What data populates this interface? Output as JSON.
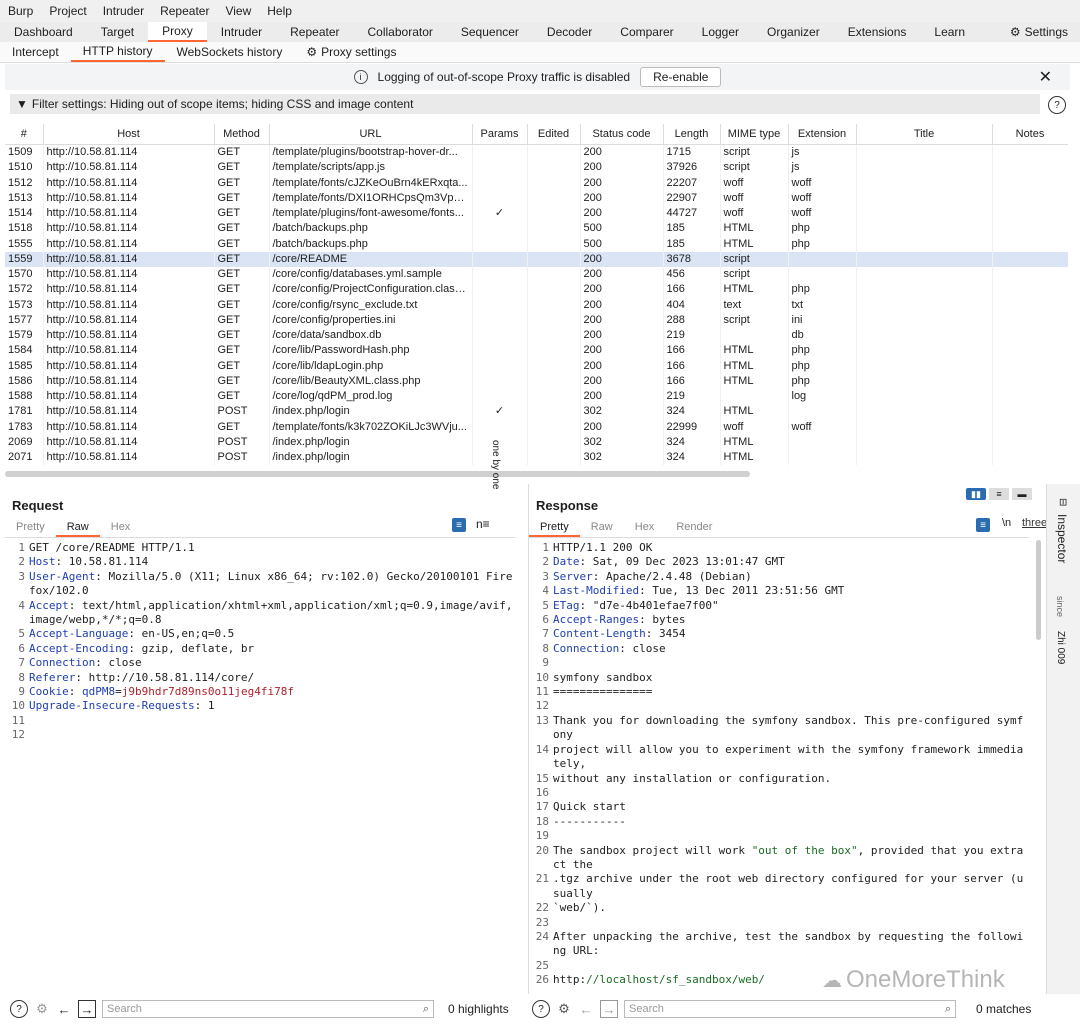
{
  "menu": [
    "Burp",
    "Project",
    "Intruder",
    "Repeater",
    "View",
    "Help"
  ],
  "main_tabs": [
    "Dashboard",
    "Target",
    "Proxy",
    "Intruder",
    "Repeater",
    "Collaborator",
    "Sequencer",
    "Decoder",
    "Comparer",
    "Logger",
    "Organizer",
    "Extensions",
    "Learn"
  ],
  "active_main_tab": "Proxy",
  "settings_label": "Settings",
  "proxy_tabs": [
    "Intercept",
    "HTTP history",
    "WebSockets history",
    "Proxy settings"
  ],
  "active_proxy_tab": "HTTP history",
  "info": {
    "message": "Logging of out-of-scope Proxy traffic is disabled",
    "button": "Re-enable"
  },
  "filter": {
    "text": "Filter settings: Hiding out of scope items;  hiding CSS and image content"
  },
  "table": {
    "columns": [
      "#",
      "Host",
      "Method",
      "URL",
      "Params",
      "Edited",
      "Status code",
      "Length",
      "MIME type",
      "Extension",
      "Title",
      "Notes"
    ],
    "rows": [
      [
        "1509",
        "http://10.58.81.114",
        "GET",
        "/template/plugins/bootstrap-hover-dr...",
        "",
        "",
        "200",
        "1715",
        "script",
        "js",
        "",
        ""
      ],
      [
        "1510",
        "http://10.58.81.114",
        "GET",
        "/template/scripts/app.js",
        "",
        "",
        "200",
        "37926",
        "script",
        "js",
        "",
        ""
      ],
      [
        "1512",
        "http://10.58.81.114",
        "GET",
        "/template/fonts/cJZKeOuBrn4kERxqta...",
        "",
        "",
        "200",
        "22207",
        "woff",
        "woff",
        "",
        ""
      ],
      [
        "1513",
        "http://10.58.81.114",
        "GET",
        "/template/fonts/DXI1ORHCpsQm3Vp6...",
        "",
        "",
        "200",
        "22907",
        "woff",
        "woff",
        "",
        ""
      ],
      [
        "1514",
        "http://10.58.81.114",
        "GET",
        "/template/plugins/font-awesome/fonts...",
        "✓",
        "",
        "200",
        "44727",
        "woff",
        "woff",
        "",
        ""
      ],
      [
        "1518",
        "http://10.58.81.114",
        "GET",
        "/batch/backups.php",
        "",
        "",
        "500",
        "185",
        "HTML",
        "php",
        "",
        ""
      ],
      [
        "1555",
        "http://10.58.81.114",
        "GET",
        "/batch/backups.php",
        "",
        "",
        "500",
        "185",
        "HTML",
        "php",
        "",
        ""
      ],
      [
        "1559",
        "http://10.58.81.114",
        "GET",
        "/core/README",
        "",
        "",
        "200",
        "3678",
        "script",
        "",
        "",
        ""
      ],
      [
        "1570",
        "http://10.58.81.114",
        "GET",
        "/core/config/databases.yml.sample",
        "",
        "",
        "200",
        "456",
        "script",
        "",
        "",
        ""
      ],
      [
        "1572",
        "http://10.58.81.114",
        "GET",
        "/core/config/ProjectConfiguration.class....",
        "",
        "",
        "200",
        "166",
        "HTML",
        "php",
        "",
        ""
      ],
      [
        "1573",
        "http://10.58.81.114",
        "GET",
        "/core/config/rsync_exclude.txt",
        "",
        "",
        "200",
        "404",
        "text",
        "txt",
        "",
        ""
      ],
      [
        "1577",
        "http://10.58.81.114",
        "GET",
        "/core/config/properties.ini",
        "",
        "",
        "200",
        "288",
        "script",
        "ini",
        "",
        ""
      ],
      [
        "1579",
        "http://10.58.81.114",
        "GET",
        "/core/data/sandbox.db",
        "",
        "",
        "200",
        "219",
        "",
        "db",
        "",
        ""
      ],
      [
        "1584",
        "http://10.58.81.114",
        "GET",
        "/core/lib/PasswordHash.php",
        "",
        "",
        "200",
        "166",
        "HTML",
        "php",
        "",
        ""
      ],
      [
        "1585",
        "http://10.58.81.114",
        "GET",
        "/core/lib/ldapLogin.php",
        "",
        "",
        "200",
        "166",
        "HTML",
        "php",
        "",
        ""
      ],
      [
        "1586",
        "http://10.58.81.114",
        "GET",
        "/core/lib/BeautyXML.class.php",
        "",
        "",
        "200",
        "166",
        "HTML",
        "php",
        "",
        ""
      ],
      [
        "1588",
        "http://10.58.81.114",
        "GET",
        "/core/log/qdPM_prod.log",
        "",
        "",
        "200",
        "219",
        "",
        "log",
        "",
        ""
      ],
      [
        "1781",
        "http://10.58.81.114",
        "POST",
        "/index.php/login",
        "✓",
        "",
        "302",
        "324",
        "HTML",
        "",
        "",
        ""
      ],
      [
        "1783",
        "http://10.58.81.114",
        "GET",
        "/template/fonts/k3k702ZOKiLJc3WVju...",
        "",
        "",
        "200",
        "22999",
        "woff",
        "woff",
        "",
        ""
      ],
      [
        "2069",
        "http://10.58.81.114",
        "POST",
        "/index.php/login",
        "",
        "",
        "302",
        "324",
        "HTML",
        "",
        "",
        ""
      ],
      [
        "2071",
        "http://10.58.81.114",
        "POST",
        "/index.php/login",
        "",
        "",
        "302",
        "324",
        "HTML",
        "",
        "",
        ""
      ]
    ],
    "selected_row": "1559"
  },
  "divider_label": "one by one",
  "request": {
    "title": "Request",
    "tabs": [
      "Pretty",
      "Raw",
      "Hex"
    ],
    "active_tab": "Raw",
    "lines": [
      {
        "n": "1",
        "t": "GET /core/README HTTP/1.1"
      },
      {
        "n": "2",
        "k": "Host",
        "v": "10.58.81.114"
      },
      {
        "n": "3",
        "k": "User-Agent",
        "v": "Mozilla/5.0 (X11; Linux x86_64; rv:102.0) Gecko/20100101 Firefox/102.0"
      },
      {
        "n": "4",
        "k": "Accept",
        "v": "text/html,application/xhtml+xml,application/xml;q=0.9,image/avif,image/webp,*/*;q=0.8"
      },
      {
        "n": "5",
        "k": "Accept-Language",
        "v": "en-US,en;q=0.5"
      },
      {
        "n": "6",
        "k": "Accept-Encoding",
        "v": "gzip, deflate, br"
      },
      {
        "n": "7",
        "k": "Connection",
        "v": "close"
      },
      {
        "n": "8",
        "k": "Referer",
        "v": "http://10.58.81.114/core/"
      },
      {
        "n": "9",
        "k": "Cookie",
        "ck": "qdPM8",
        "cv": "j9b9hdr7d89ns0o11jeg4fi78f"
      },
      {
        "n": "10",
        "k": "Upgrade-Insecure-Requests",
        "v": "1"
      },
      {
        "n": "11",
        "t": ""
      },
      {
        "n": "12",
        "t": ""
      }
    ],
    "search_placeholder": "Search",
    "highlights": "0 highlights"
  },
  "response": {
    "title": "Response",
    "tabs": [
      "Pretty",
      "Raw",
      "Hex",
      "Render"
    ],
    "active_tab": "Pretty",
    "lines": [
      {
        "n": "1",
        "t": "HTTP/1.1 200 OK"
      },
      {
        "n": "2",
        "k": "Date",
        "v": "Sat, 09 Dec 2023 13:01:47 GMT"
      },
      {
        "n": "3",
        "k": "Server",
        "v": "Apache/2.4.48 (Debian)"
      },
      {
        "n": "4",
        "k": "Last-Modified",
        "v": "Tue, 13 Dec 2011 23:51:56 GMT"
      },
      {
        "n": "5",
        "k": "ETag",
        "v": "\"d7e-4b401efae7f00\""
      },
      {
        "n": "6",
        "k": "Accept-Ranges",
        "v": "bytes"
      },
      {
        "n": "7",
        "k": "Content-Length",
        "v": "3454"
      },
      {
        "n": "8",
        "k": "Connection",
        "v": "close"
      },
      {
        "n": "9",
        "t": ""
      },
      {
        "n": "10",
        "t": "symfony sandbox"
      },
      {
        "n": "11",
        "t": "==============="
      },
      {
        "n": "12",
        "t": ""
      },
      {
        "n": "13",
        "t": "Thank you for downloading the symfony sandbox. This pre-configured symfony"
      },
      {
        "n": "14",
        "t": "project will allow you to experiment with the symfony framework immediately,"
      },
      {
        "n": "15",
        "t": "without any installation or configuration."
      },
      {
        "n": "16",
        "t": ""
      },
      {
        "n": "17",
        "t": "Quick start"
      },
      {
        "n": "18",
        "t": "-----------"
      },
      {
        "n": "19",
        "t": ""
      },
      {
        "n": "20",
        "t": "The sandbox project will work \"out of the box\", provided that you extract the"
      },
      {
        "n": "21",
        "t": ".tgz archive under the root web directory configured for your server (usually"
      },
      {
        "n": "22",
        "t": "`web/`)."
      },
      {
        "n": "23",
        "t": ""
      },
      {
        "n": "24",
        "t": "After unpacking the archive, test the sandbox by requesting the following URL:"
      },
      {
        "n": "25",
        "t": ""
      },
      {
        "n": "26",
        "t": "http://localhost/sf_sandbox/web/"
      }
    ],
    "search_placeholder": "Search",
    "matches": "0 matches",
    "ln_label": "\\n",
    "view_label": "three"
  },
  "inspector": {
    "label": "Inspector",
    "side_a": "since",
    "side_b": "Zhi 009"
  },
  "watermark": "OneMoreThink"
}
